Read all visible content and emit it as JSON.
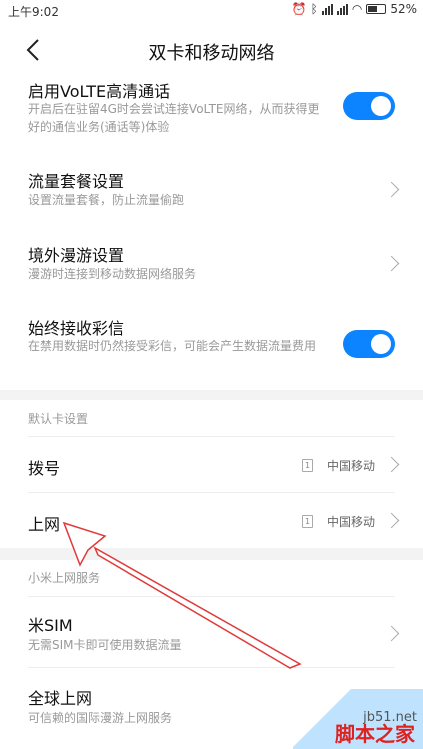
{
  "status": {
    "time": "上午9:02",
    "battery": "52%"
  },
  "header": {
    "title": "双卡和移动网络"
  },
  "rows": {
    "volte": {
      "title": "启用VoLTE高清通话",
      "subtitle": "开启后在驻留4G时会尝试连接VoLTE网络，从而获得更好的通信业务(通话等)体验",
      "toggle": "on"
    },
    "data_plan": {
      "title": "流量套餐设置",
      "subtitle": "设置流量套餐，防止流量偷跑"
    },
    "roaming": {
      "title": "境外漫游设置",
      "subtitle": "漫游时连接到移动数据网络服务"
    },
    "mms": {
      "title": "始终接收彩信",
      "subtitle": "在禁用数据时仍然接受彩信，可能会产生数据流量费用",
      "toggle": "on"
    }
  },
  "default_card": {
    "section_label": "默认卡设置",
    "dial": {
      "title": "拨号",
      "sim": "1",
      "carrier": "中国移动"
    },
    "internet": {
      "title": "上网",
      "sim": "1",
      "carrier": "中国移动"
    }
  },
  "mi_service": {
    "section_label": "小米上网服务",
    "misim": {
      "title": "米SIM",
      "subtitle": "无需SIM卡即可使用数据流量"
    },
    "global": {
      "title": "全球上网",
      "subtitle": "可信赖的国际漫游上网服务"
    }
  },
  "watermark": {
    "url": "jb51.net",
    "logo": "脚本之家"
  },
  "colors": {
    "toggle_on": "#0d84ff",
    "arrow": "#e03a3a"
  }
}
